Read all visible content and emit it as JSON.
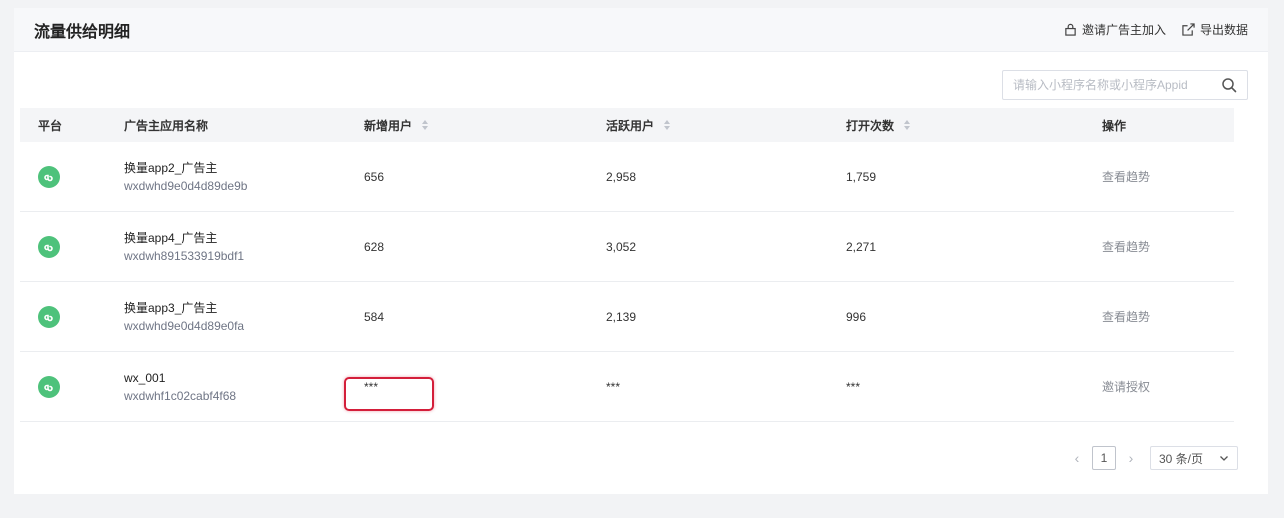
{
  "header": {
    "title": "流量供给明细",
    "invite_label": "邀请广告主加入",
    "export_label": "导出数据"
  },
  "search": {
    "placeholder": "请输入小程序名称或小程序Appid"
  },
  "table": {
    "columns": {
      "platform": "平台",
      "app_name": "广告主应用名称",
      "new_users": "新增用户",
      "active_users": "活跃用户",
      "opens": "打开次数",
      "action": "操作"
    },
    "rows": [
      {
        "name": "换量app2_广告主",
        "appid": "wxdwhd9e0d4d89de9b",
        "new_users": "656",
        "active_users": "2,958",
        "opens": "1,759",
        "action": "查看趋势"
      },
      {
        "name": "换量app4_广告主",
        "appid": "wxdwh891533919bdf1",
        "new_users": "628",
        "active_users": "3,052",
        "opens": "2,271",
        "action": "查看趋势"
      },
      {
        "name": "换量app3_广告主",
        "appid": "wxdwhd9e0d4d89e0fa",
        "new_users": "584",
        "active_users": "2,139",
        "opens": "996",
        "action": "查看趋势"
      },
      {
        "name": "wx_001",
        "appid": "wxdwhf1c02cabf4f68",
        "new_users": "***",
        "active_users": "***",
        "opens": "***",
        "action": "邀请授权"
      }
    ]
  },
  "pagination": {
    "current_page": "1",
    "page_size": "30 条/页"
  },
  "colors": {
    "platform_icon": "#4ec27b",
    "highlight_border": "#d41e3a"
  }
}
